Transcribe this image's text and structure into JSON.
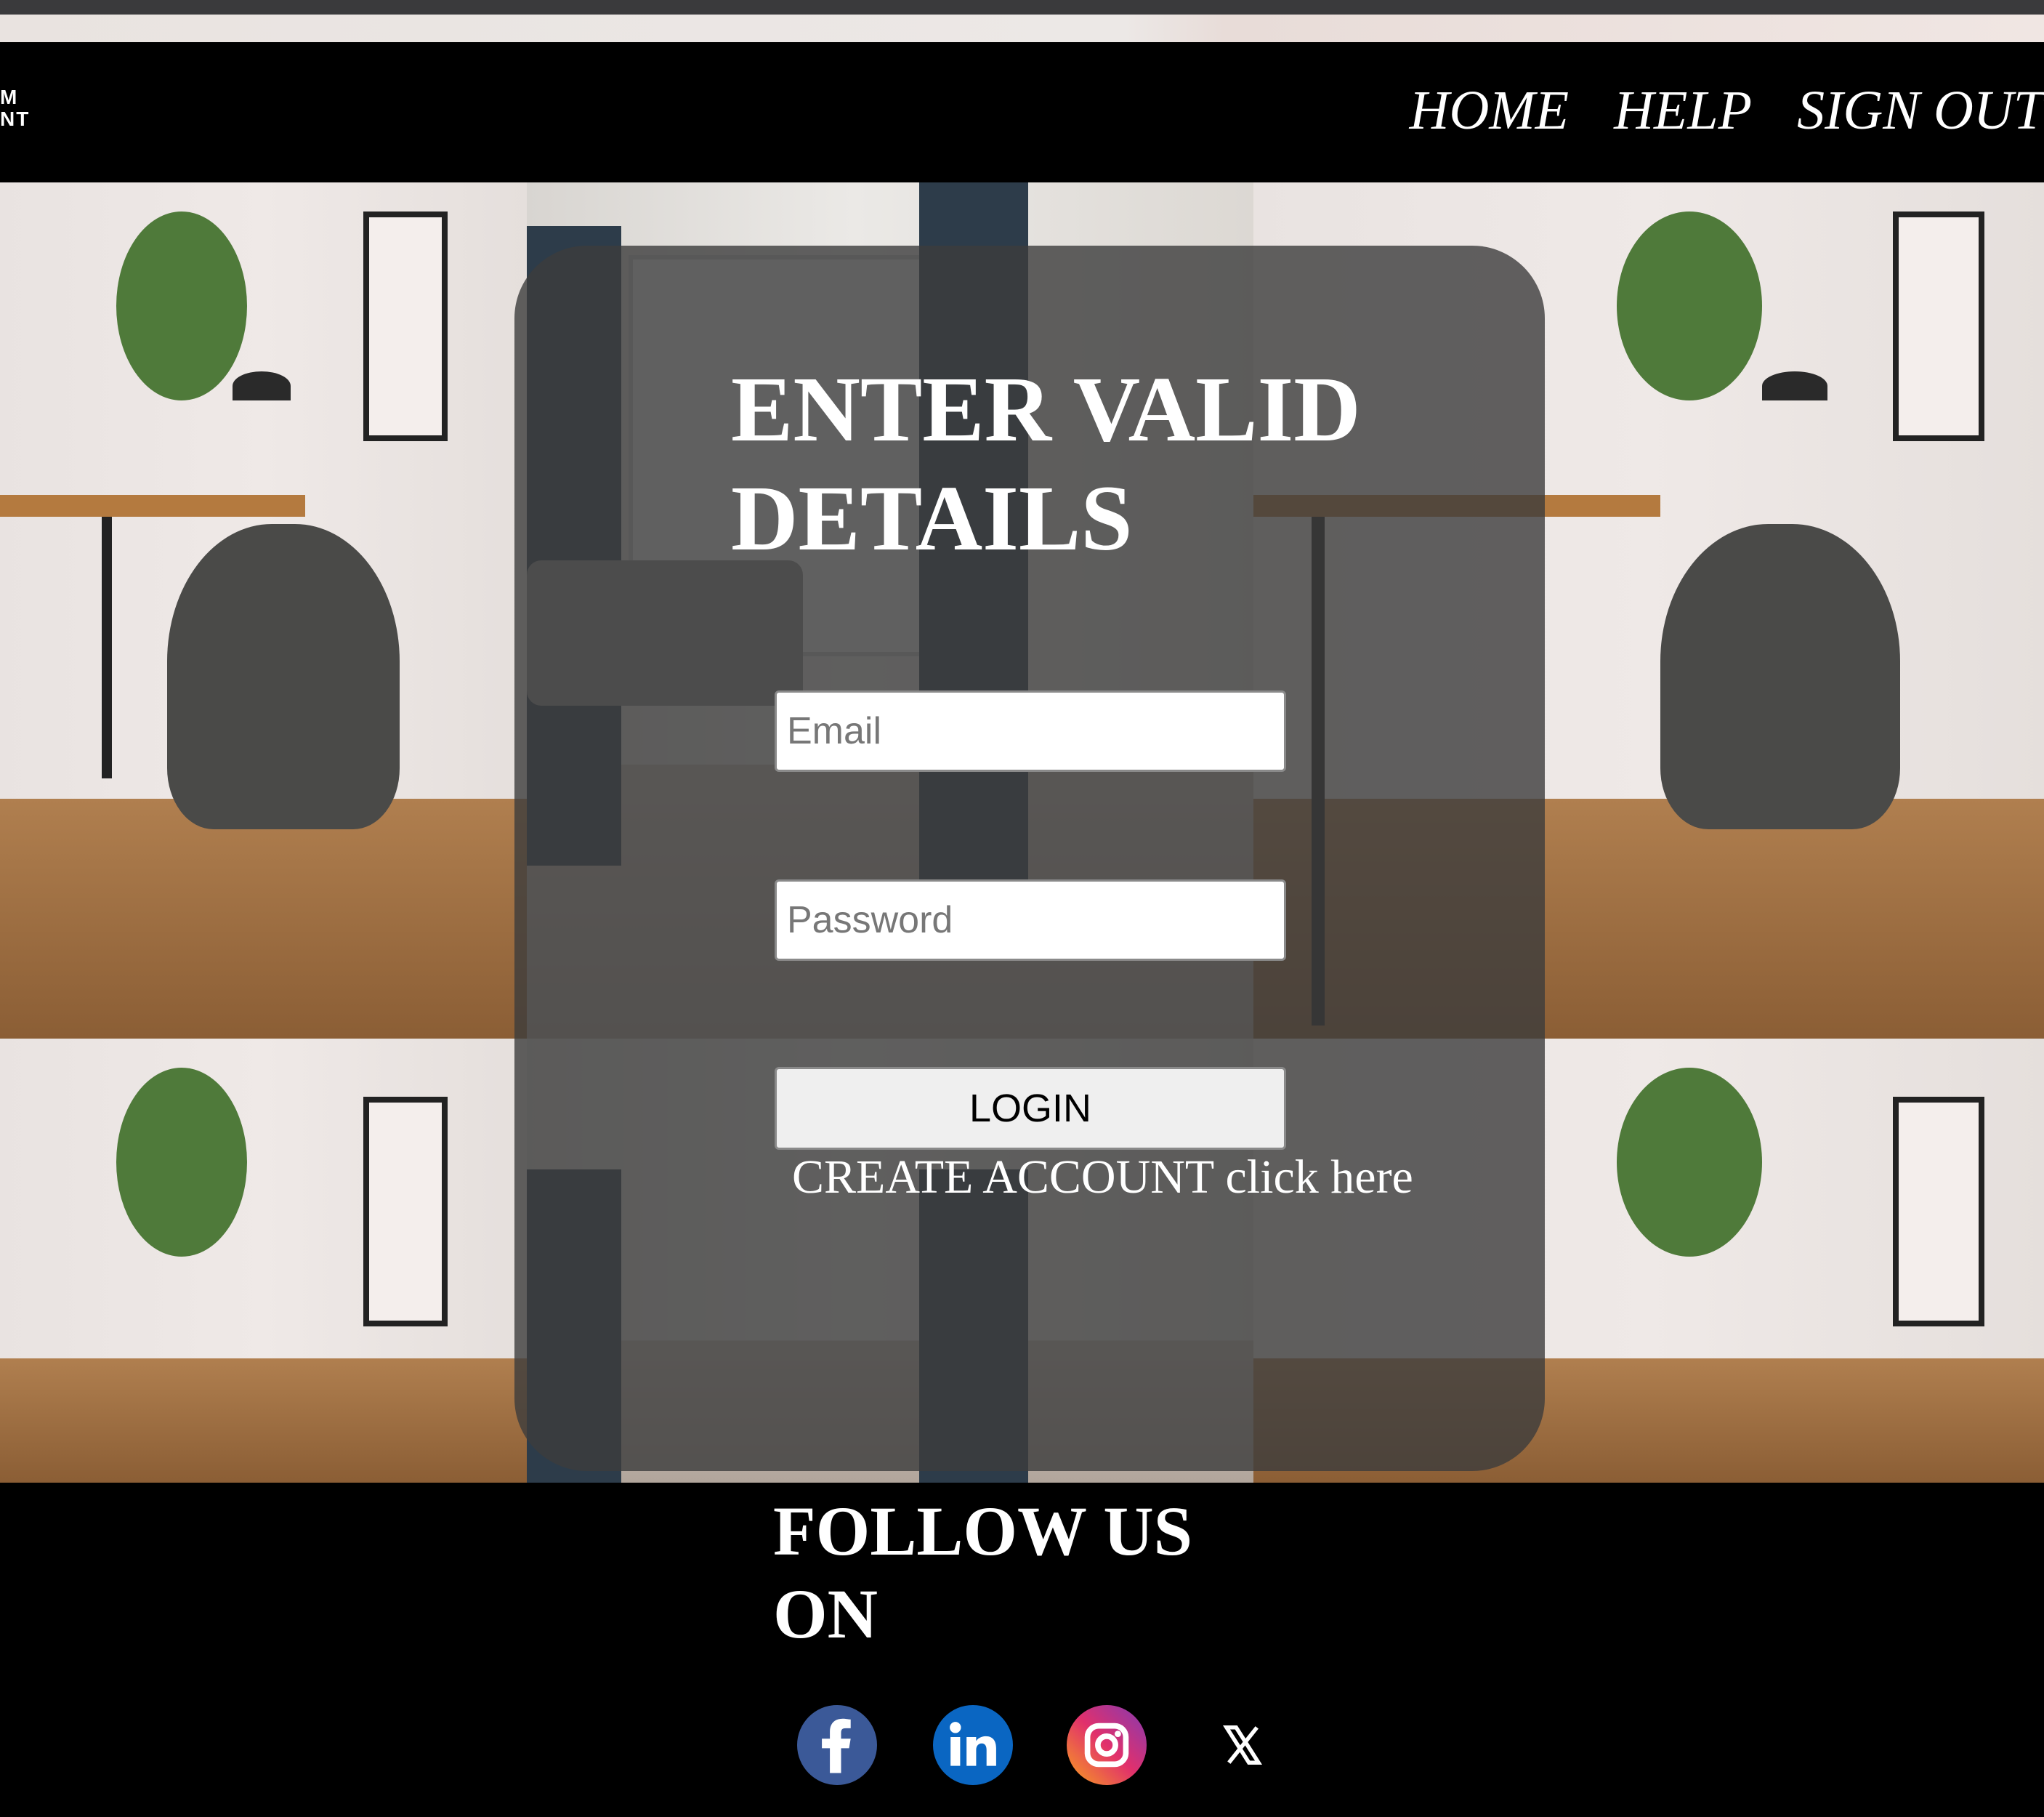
{
  "navbar": {
    "logo": {
      "line1": "M",
      "line2": "NT"
    },
    "links": [
      "HOME",
      "HELP",
      "SIGN OUT"
    ]
  },
  "login": {
    "title": "ENTER VALID DETAILS",
    "email_placeholder": "Email",
    "password_placeholder": "Password",
    "login_label": "LOGIN",
    "create_account_text": "CREATE ACCOUNT click here"
  },
  "footer": {
    "follow_title": "FOLLOW US ON",
    "social_icons": [
      "facebook-icon",
      "linkedin-icon",
      "instagram-icon",
      "x-icon"
    ]
  },
  "colors": {
    "navbar_bg": "#000000",
    "card_overlay": "#3c3c3c",
    "facebook": "#3b5998",
    "linkedin": "#0a66c2",
    "instagram": "#d6249f"
  }
}
